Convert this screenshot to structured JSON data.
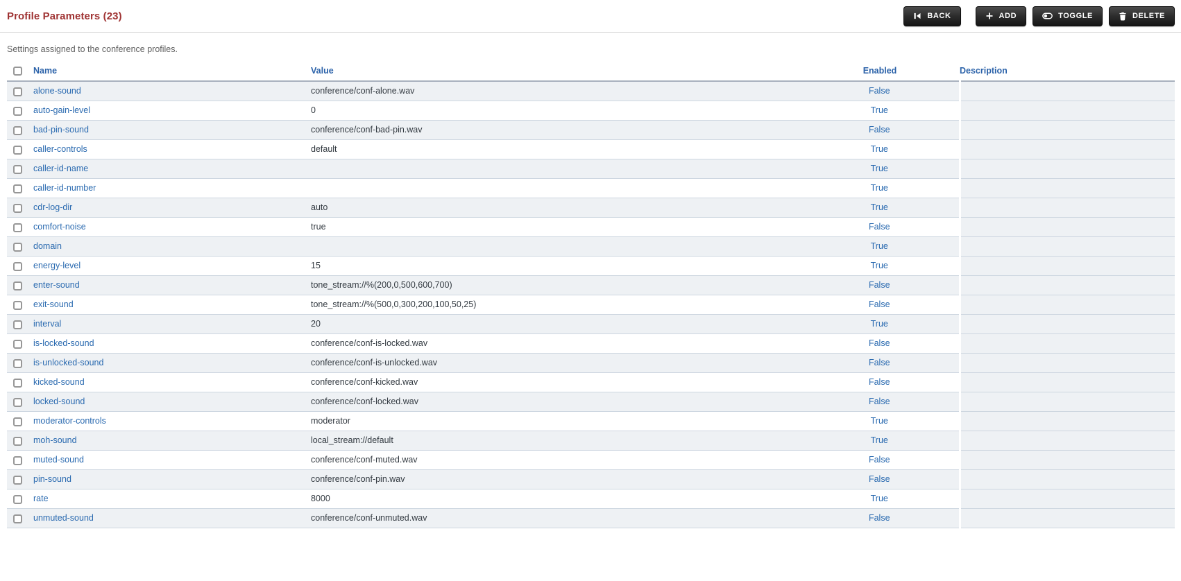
{
  "header": {
    "title": "Profile Parameters (23)",
    "subtitle": "Settings assigned to the conference profiles.",
    "buttons": [
      {
        "label": "BACK",
        "icon": "skip-back-icon"
      },
      {
        "label": "ADD",
        "icon": "plus-icon"
      },
      {
        "label": "TOGGLE",
        "icon": "toggle-icon"
      },
      {
        "label": "DELETE",
        "icon": "trash-icon"
      }
    ]
  },
  "colors": {
    "title_red": "#9f3333",
    "header_blue": "#2b62a9",
    "link_blue": "#2a6ab0",
    "row_stripe": "#eef1f4",
    "row_border": "#cdd6e0",
    "button_dark": "#2c2c2c"
  },
  "table": {
    "columns": {
      "name": "Name",
      "value": "Value",
      "enabled": "Enabled",
      "description": "Description"
    },
    "rows": [
      {
        "name": "alone-sound",
        "value": "conference/conf-alone.wav",
        "enabled": "False",
        "description": ""
      },
      {
        "name": "auto-gain-level",
        "value": "0",
        "enabled": "True",
        "description": ""
      },
      {
        "name": "bad-pin-sound",
        "value": "conference/conf-bad-pin.wav",
        "enabled": "False",
        "description": ""
      },
      {
        "name": "caller-controls",
        "value": "default",
        "enabled": "True",
        "description": ""
      },
      {
        "name": "caller-id-name",
        "value": "",
        "enabled": "True",
        "description": ""
      },
      {
        "name": "caller-id-number",
        "value": "",
        "enabled": "True",
        "description": ""
      },
      {
        "name": "cdr-log-dir",
        "value": "auto",
        "enabled": "True",
        "description": ""
      },
      {
        "name": "comfort-noise",
        "value": "true",
        "enabled": "False",
        "description": ""
      },
      {
        "name": "domain",
        "value": "",
        "enabled": "True",
        "description": ""
      },
      {
        "name": "energy-level",
        "value": "15",
        "enabled": "True",
        "description": ""
      },
      {
        "name": "enter-sound",
        "value": "tone_stream://%(200,0,500,600,700)",
        "enabled": "False",
        "description": ""
      },
      {
        "name": "exit-sound",
        "value": "tone_stream://%(500,0,300,200,100,50,25)",
        "enabled": "False",
        "description": ""
      },
      {
        "name": "interval",
        "value": "20",
        "enabled": "True",
        "description": ""
      },
      {
        "name": "is-locked-sound",
        "value": "conference/conf-is-locked.wav",
        "enabled": "False",
        "description": ""
      },
      {
        "name": "is-unlocked-sound",
        "value": "conference/conf-is-unlocked.wav",
        "enabled": "False",
        "description": ""
      },
      {
        "name": "kicked-sound",
        "value": "conference/conf-kicked.wav",
        "enabled": "False",
        "description": ""
      },
      {
        "name": "locked-sound",
        "value": "conference/conf-locked.wav",
        "enabled": "False",
        "description": ""
      },
      {
        "name": "moderator-controls",
        "value": "moderator",
        "enabled": "True",
        "description": ""
      },
      {
        "name": "moh-sound",
        "value": "local_stream://default",
        "enabled": "True",
        "description": ""
      },
      {
        "name": "muted-sound",
        "value": "conference/conf-muted.wav",
        "enabled": "False",
        "description": ""
      },
      {
        "name": "pin-sound",
        "value": "conference/conf-pin.wav",
        "enabled": "False",
        "description": ""
      },
      {
        "name": "rate",
        "value": "8000",
        "enabled": "True",
        "description": ""
      },
      {
        "name": "unmuted-sound",
        "value": "conference/conf-unmuted.wav",
        "enabled": "False",
        "description": ""
      }
    ]
  }
}
